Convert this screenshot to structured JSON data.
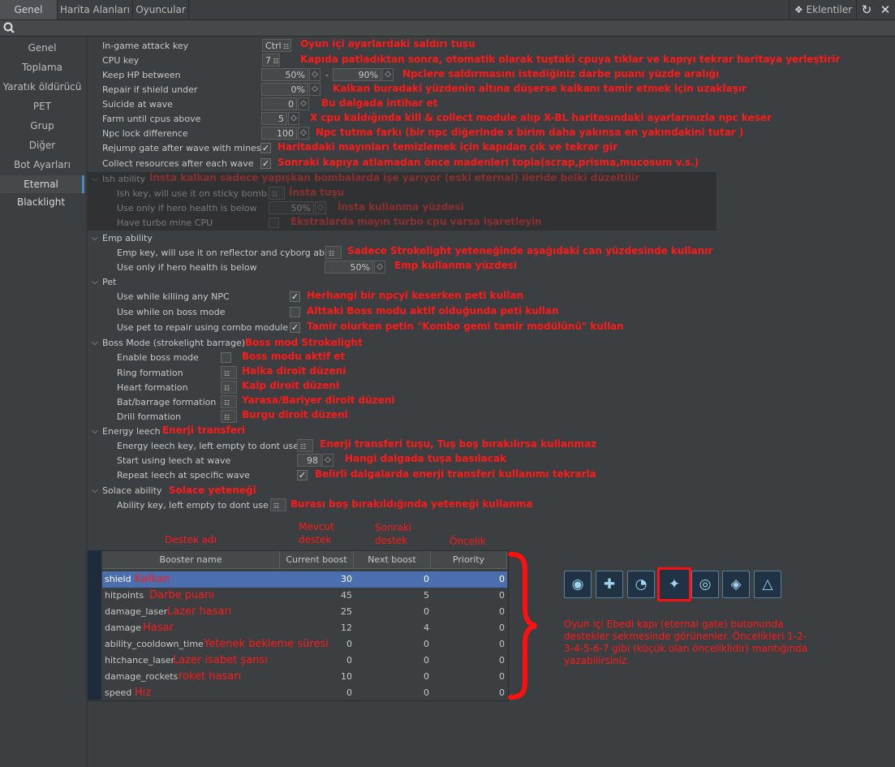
{
  "tabs": [
    "Genel",
    "Harita Alanları",
    "Oyuncular"
  ],
  "plugins_label": "Eklentiler",
  "sidebar": [
    "Genel",
    "Toplama",
    "Yaratık öldürücü",
    "PET",
    "Grup",
    "Diğer",
    "Bot Ayarları",
    "Eternal Blacklight"
  ],
  "rows": {
    "attack_key": {
      "label": "In-game attack key",
      "value": "Ctrl",
      "note": "Oyun içi ayarlardaki saldırı tuşu"
    },
    "cpu_key": {
      "label": "CPU key",
      "value": "7",
      "note": "Kapıda patladıktan sonra, otomatik olarak tuştaki cpuya tıklar ve kapıyı tekrar haritaya yerleştirir"
    },
    "keep_hp": {
      "label": "Keep HP between",
      "value1": "50%",
      "value2": "90%",
      "note": "Npclere saldırmasını istediğiniz darbe puanı yüzde aralığı"
    },
    "repair": {
      "label": "Repair if shield under",
      "value": "0%",
      "note": "Kalkan buradaki yüzdenin altına düşerse kalkanı tamir etmek için uzaklaşır"
    },
    "suicide": {
      "label": "Suicide at wave",
      "value": "0",
      "note": "Bu dalgada intihar et"
    },
    "farm": {
      "label": "Farm until cpus above",
      "value": "5",
      "note": "X cpu kaldığında kill & collect module alıp X-BL haritasındaki ayarlarınızla npc keser"
    },
    "npc_lock": {
      "label": "Npc lock difference",
      "value": "100",
      "note": "Npc tutma farkı (bir npc diğerinde x birim daha yakınsa en yakındakini tutar )"
    },
    "rejump": {
      "label": "Rejump gate after wave with mines",
      "note": "Haritadaki mayınları temizlemek için kapıdan çık ve tekrar gir"
    },
    "collect": {
      "label": "Collect resources after each wave",
      "note": "Sonraki kapıya atlamadan önce madenleri topla(scrap,prisma,mucosum v.s.)"
    }
  },
  "ish": {
    "title": "Ish ability",
    "title_note": "İnsta kalkan sadece yapışkan bombalarda işe yarıyor (eski eternal) ileride belki düzeltilir",
    "key": {
      "label": "Ish key, will use it on sticky bomb",
      "note": "İnsta tuşu"
    },
    "health": {
      "label": "Use only if hero health is below",
      "value": "50%",
      "note": "İnsta kullanma yüzdesi"
    },
    "turbo": {
      "label": "Have turbo mine CPU",
      "note": "Ekstralarda mayın turbo cpu varsa işaretleyin"
    }
  },
  "emp": {
    "title": "Emp ability",
    "key": {
      "label": "Emp key, will use it on reflector and cyborg abl",
      "note": "Sadece Strokelight yeteneğinde aşağıdaki can yüzdesinde kullanır"
    },
    "health": {
      "label": "Use only if hero health is below",
      "value": "50%",
      "note": "Emp kullanma yüzdesi"
    }
  },
  "pet": {
    "title": "Pet",
    "npc": {
      "label": "Use while killing any NPC",
      "note": "Herhangi bir npcyi keserken peti kullan"
    },
    "boss": {
      "label": "Use while on boss mode",
      "note": "Alttaki Boss modu aktif olduğunda peti kullan"
    },
    "repair": {
      "label": "Use pet to repair using combo module",
      "note": "Tamir olurken petin \"Kombo gemi tamir modülünü\" kullan"
    }
  },
  "boss": {
    "title": "Boss Mode (strokelight barrage)",
    "title_note": "Boss mod Strokelight",
    "enable": {
      "label": "Enable boss mode",
      "note": "Boss modu aktif et"
    },
    "ring": {
      "label": "Ring formation",
      "note": "Halka diroit düzeni"
    },
    "heart": {
      "label": "Heart formation",
      "note": "Kalp diroit düzeni"
    },
    "bat": {
      "label": "Bat/barrage formation",
      "note": "Yarasa/Bariyer diroit düzeni"
    },
    "drill": {
      "label": "Drill formation",
      "note": "Burgu diroit düzeni"
    }
  },
  "leech": {
    "title": "Energy leech",
    "title_note": "Enerji transferi",
    "key": {
      "label": "Energy leech key, left empty to dont use",
      "note": "Enerji transferi tuşu, Tuş boş bırakılırsa kullanmaz"
    },
    "start": {
      "label": "Start using leech at wave",
      "value": "98",
      "note": "Hangi dalgada tuşa basılacak"
    },
    "repeat": {
      "label": "Repeat leech at specific wave",
      "note": "Belirli dalgalarda enerji transferi kullanımı tekrarla"
    }
  },
  "solace": {
    "title": "Solace ability",
    "title_note": "Solace yeteneği",
    "key": {
      "label": "Ability key, left empty to dont use",
      "note": "Burası boş bırakıldığında yeteneği kullanma"
    }
  },
  "table": {
    "headers": [
      "Booster name",
      "Current boost",
      "Next boost",
      "Priority"
    ],
    "header_notes": [
      "Destek adı",
      "Mevcut destek",
      "Sonraki destek",
      "Öncelik"
    ],
    "rows": [
      {
        "name": "shield",
        "note": "Kalkan",
        "current": "30",
        "next": "0",
        "priority": "0"
      },
      {
        "name": "hitpoints",
        "note": "Darbe puanı",
        "current": "45",
        "next": "5",
        "priority": "0"
      },
      {
        "name": "damage_laser",
        "note": "Lazer hasarı",
        "current": "25",
        "next": "0",
        "priority": "0"
      },
      {
        "name": "damage",
        "note": "Hasar",
        "current": "12",
        "next": "4",
        "priority": "0"
      },
      {
        "name": "ability_cooldown_time",
        "note": "Yetenek bekleme süresi",
        "current": "0",
        "next": "0",
        "priority": "0"
      },
      {
        "name": "hitchance_laser",
        "note": "Lazer isabet şansı",
        "current": "0",
        "next": "0",
        "priority": "0"
      },
      {
        "name": "damage_rockets",
        "note": "roket hasarı",
        "current": "10",
        "next": "0",
        "priority": "0"
      },
      {
        "name": "speed",
        "note": "Hız",
        "current": "0",
        "next": "0",
        "priority": "0"
      }
    ]
  },
  "booster_note": "Oyun içi Ebedi kapı (eternal gate) butonunda destekler sekmesinde görünenler. Öncelikleri 1-2-3-4-5-6-7 gibi (küçük olan önceliklidir) mantığında yazabilirsiniz.",
  "colors": {
    "annotation": "#ff1a1a",
    "selection": "#4b6eaf",
    "accent": "#4a88c7"
  }
}
